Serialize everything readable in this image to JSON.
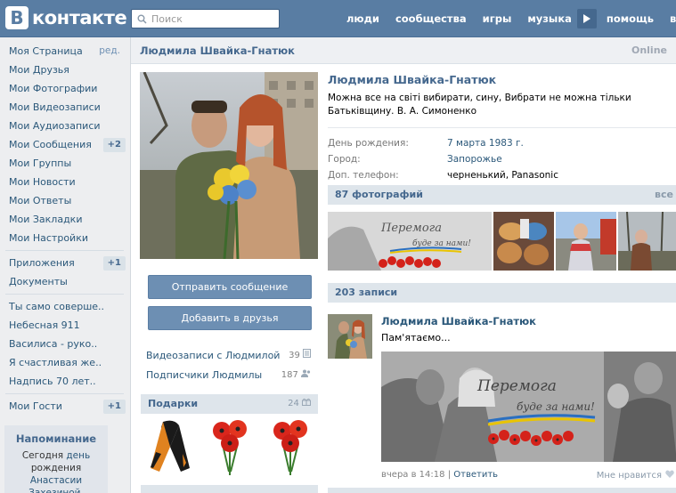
{
  "header": {
    "logo_letter": "В",
    "logo_text": "контакте",
    "search_placeholder": "Поиск",
    "nav": [
      "люди",
      "сообщества",
      "игры",
      "музыка",
      "помощь",
      "вы"
    ]
  },
  "left_menu": {
    "items": [
      {
        "label": "Моя Страница",
        "extra": "ред."
      },
      {
        "label": "Мои Друзья"
      },
      {
        "label": "Мои Фотографии"
      },
      {
        "label": "Мои Видеозаписи"
      },
      {
        "label": "Мои Аудиозаписи"
      },
      {
        "label": "Мои Сообщения",
        "badge": "+2"
      },
      {
        "label": "Мои Группы"
      },
      {
        "label": "Мои Новости"
      },
      {
        "label": "Мои Ответы"
      },
      {
        "label": "Мои Закладки"
      },
      {
        "label": "Мои Настройки"
      }
    ],
    "apps": [
      {
        "label": "Приложения",
        "badge": "+1"
      },
      {
        "label": "Документы"
      }
    ],
    "games": [
      "Ты само соверше..",
      "Небесная 911",
      "Василиса - руко..",
      "Я счастливая же..",
      "Надпись 70 лет.."
    ],
    "guests": {
      "label": "Мои Гости",
      "badge": "+1"
    },
    "reminder": {
      "title": "Напоминание",
      "line1": "Сегодня ",
      "link1": "день",
      "line2": "рождения ",
      "link2": "Анастасии Захезиной",
      "end": "."
    }
  },
  "profile": {
    "header_name": "Людмила Швайка-Гнатюк",
    "online": "Online",
    "name": "Людмила Швайка-Гнатюк",
    "status": "Можна все на світі вибирати, сину, Вибрати не можна тільки Батьківщину. В. А. Симоненко",
    "info": [
      {
        "label": "День рождения:",
        "value": "7 марта 1983 г.",
        "link": true
      },
      {
        "label": "Город:",
        "value": "Запорожье",
        "link": true
      },
      {
        "label": "Доп. телефон:",
        "value": "черненький, Panasonic",
        "link": false
      }
    ],
    "send_message": "Отправить сообщение",
    "add_friend": "Добавить в друзья",
    "videos_label": "Видеозаписи с Людмилой",
    "videos_count": "39",
    "subs_label": "Подписчики Людмилы",
    "subs_count": "187",
    "gifts_label": "Подарки",
    "gifts_count": "24",
    "photos_title": "87 фотографий",
    "photos_all": "все",
    "posts_title": "203 записи",
    "photo_caption_1": "Перемога",
    "photo_caption_2": "буде за нами!"
  },
  "post": {
    "author": "Людмила Швайка-Гнатюк",
    "text": "Пам'ятаємо...",
    "time": "вчера в 14:18",
    "reply": "Ответить",
    "like": "Мне нравится"
  },
  "colors": {
    "header": "#597da3",
    "link": "#2b587a",
    "accent": "#45688e",
    "button": "#6d8fb3"
  }
}
